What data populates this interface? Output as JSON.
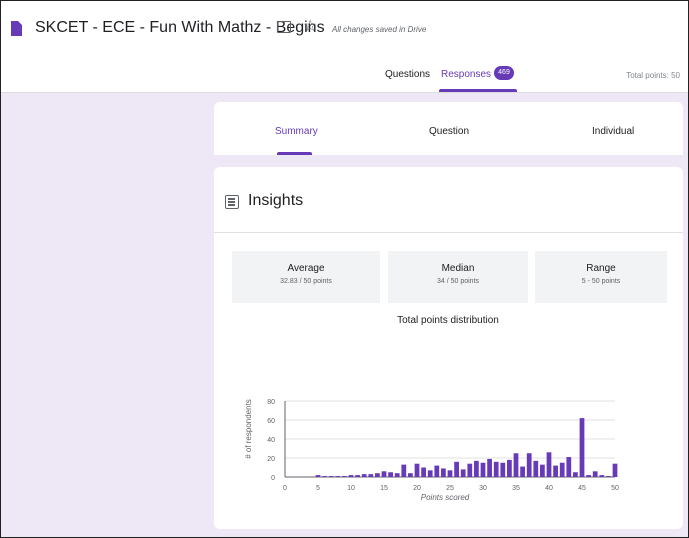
{
  "header": {
    "title": "SKCET - ECE - Fun With Mathz - Begins",
    "saved_status": "All changes saved in Drive",
    "tabs": {
      "questions": "Questions",
      "responses": "Responses"
    },
    "responses_count": "469",
    "total_points": "Total points: 50"
  },
  "subtabs": {
    "summary": "Summary",
    "question": "Question",
    "individual": "Individual"
  },
  "insights": {
    "title": "Insights",
    "stats": {
      "average_label": "Average",
      "average_value": "32.83 / 50 points",
      "median_label": "Median",
      "median_value": "34 / 50 points",
      "range_label": "Range",
      "range_value": "5 - 50 points"
    }
  },
  "colors": {
    "accent": "#673ab7",
    "background": "#ede7f6"
  },
  "icons": {
    "doc": "doc-icon",
    "folder": "folder-icon",
    "star": "star-icon",
    "insights": "insights-icon"
  },
  "chart_data": {
    "type": "bar",
    "title": "Total points distribution",
    "xlabel": "Points scored",
    "ylabel": "# of respondents",
    "xlim": [
      0,
      50
    ],
    "ylim": [
      0,
      80
    ],
    "xticks": [
      0,
      5,
      10,
      15,
      20,
      25,
      30,
      35,
      40,
      45,
      50
    ],
    "yticks": [
      0,
      20,
      40,
      60,
      80
    ],
    "x": [
      5,
      6,
      7,
      8,
      9,
      10,
      11,
      12,
      13,
      14,
      15,
      16,
      17,
      18,
      19,
      20,
      21,
      22,
      23,
      24,
      25,
      26,
      27,
      28,
      29,
      30,
      31,
      32,
      33,
      34,
      35,
      36,
      37,
      38,
      39,
      40,
      41,
      42,
      43,
      44,
      45,
      46,
      47,
      48,
      49,
      50
    ],
    "values": [
      2,
      1,
      1,
      1,
      1,
      2,
      2,
      3,
      3,
      4,
      6,
      5,
      4,
      13,
      4,
      14,
      10,
      7,
      12,
      9,
      7,
      16,
      8,
      14,
      17,
      15,
      19,
      16,
      15,
      18,
      25,
      11,
      25,
      17,
      13,
      26,
      12,
      15,
      21,
      5,
      62,
      2,
      6,
      2,
      1,
      14
    ]
  }
}
